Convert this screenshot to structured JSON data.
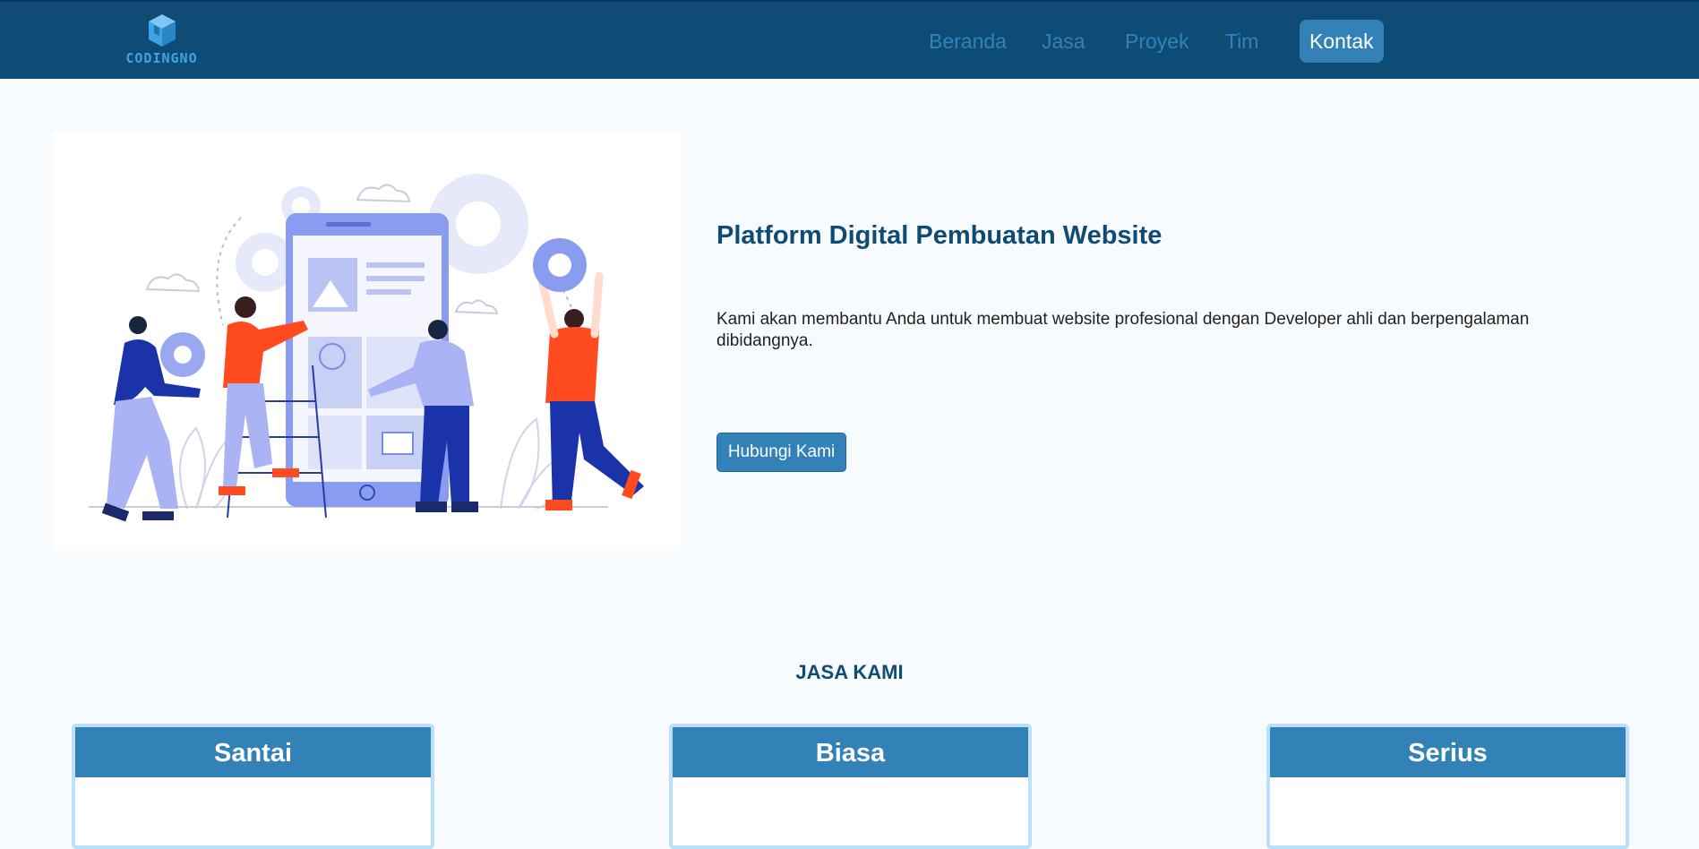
{
  "brand": {
    "logo_text": "CODINGNO"
  },
  "nav": {
    "items": [
      "Beranda",
      "Jasa",
      "Proyek",
      "Tim"
    ],
    "active": "Kontak"
  },
  "hero": {
    "title": "Platform Digital Pembuatan Website",
    "description": "Kami akan membantu Anda untuk membuat website profesional dengan Developer ahli dan berpengalaman dibidangnya.",
    "button_label": "Hubungi Kami"
  },
  "services": {
    "title": "JASA KAMI",
    "cards": [
      "Santai",
      "Biasa",
      "Serius"
    ]
  },
  "colors": {
    "navbar": "#0f4c75",
    "accent": "#3282b8",
    "card_border": "#bbe1fa",
    "page_bg": "#f7fbfe"
  }
}
